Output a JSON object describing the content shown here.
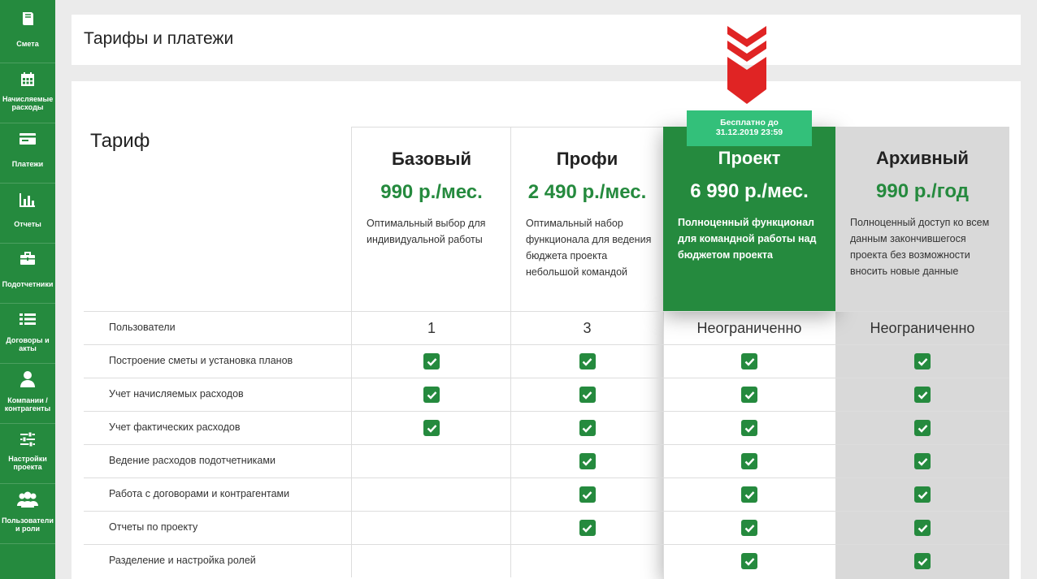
{
  "sidebar": {
    "items": [
      {
        "label": "Смета",
        "icon": "book-icon"
      },
      {
        "label": "Начисляемые расходы",
        "icon": "calendar-icon"
      },
      {
        "label": "Платежи",
        "icon": "card-icon"
      },
      {
        "label": "Отчеты",
        "icon": "bar-chart-icon"
      },
      {
        "label": "Подотчетники",
        "icon": "briefcase-icon"
      },
      {
        "label": "Договоры и акты",
        "icon": "list-icon"
      },
      {
        "label": "Компании / контрагенты",
        "icon": "user-icon"
      },
      {
        "label": "Настройки проекта",
        "icon": "sliders-icon"
      },
      {
        "label": "Пользователи и роли",
        "icon": "users-icon"
      }
    ]
  },
  "header": {
    "title": "Тарифы и платежи"
  },
  "pricing": {
    "label": "Тариф",
    "badge": {
      "line1": "Бесплатно до",
      "line2": "31.12.2019 23:59"
    },
    "plans": [
      {
        "name": "Базовый",
        "price": "990 р./мес.",
        "desc": "Оптимальный выбор для индивидуальной работы"
      },
      {
        "name": "Профи",
        "price": "2 490 р./мес.",
        "desc": "Оптимальный набор функционала для ведения бюджета проекта небольшой командой"
      },
      {
        "name": "Проект",
        "price": "6 990 р./мес.",
        "desc": "Полноценный функционал для командной работы над бюджетом проекта"
      },
      {
        "name": "Архивный",
        "price": "990 р./год",
        "desc": "Полноценный доступ ко всем данным закончившегося проекта без возможности вносить новые данные"
      }
    ],
    "features": [
      {
        "label": "Пользователи",
        "values": [
          "1",
          "3",
          "Неограниченно",
          "Неограниченно"
        ]
      },
      {
        "label": "Построение сметы и установка планов",
        "values": [
          true,
          true,
          true,
          true
        ]
      },
      {
        "label": "Учет начисляемых расходов",
        "values": [
          true,
          true,
          true,
          true
        ]
      },
      {
        "label": "Учет фактических расходов",
        "values": [
          true,
          true,
          true,
          true
        ]
      },
      {
        "label": "Ведение расходов подотчетниками",
        "values": [
          false,
          true,
          true,
          true
        ]
      },
      {
        "label": "Работа с договорами и контрагентами",
        "values": [
          false,
          true,
          true,
          true
        ]
      },
      {
        "label": "Отчеты по проекту",
        "values": [
          false,
          true,
          true,
          true
        ]
      },
      {
        "label": "Разделение и настройка ролей",
        "values": [
          false,
          false,
          true,
          true
        ]
      }
    ]
  },
  "colors": {
    "brand": "#258a3e",
    "badge": "#33c07a",
    "arrow": "#e02424",
    "archive": "#d9d9d9"
  }
}
